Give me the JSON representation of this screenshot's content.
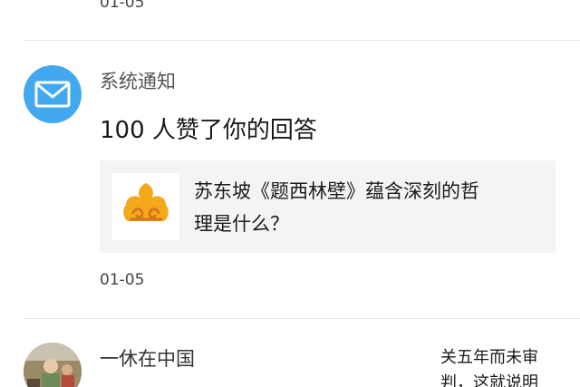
{
  "previous_item": {
    "date": "01-05"
  },
  "notification": {
    "sender": "系统通知",
    "message": "100 人赞了你的回答",
    "card": {
      "question_line1": "苏东坡《题西林壁》蕴含深刻的哲",
      "question_line2": "理是什么？"
    },
    "date": "01-05",
    "avatar_icon": "mail-icon",
    "avatar_color": "#42a8f0",
    "thumb_icon": "cloud-logo-icon"
  },
  "next_item": {
    "user_name": "一休在中国",
    "snippet_line1": "关五年而未审",
    "snippet_line2": "判，这就说明"
  }
}
